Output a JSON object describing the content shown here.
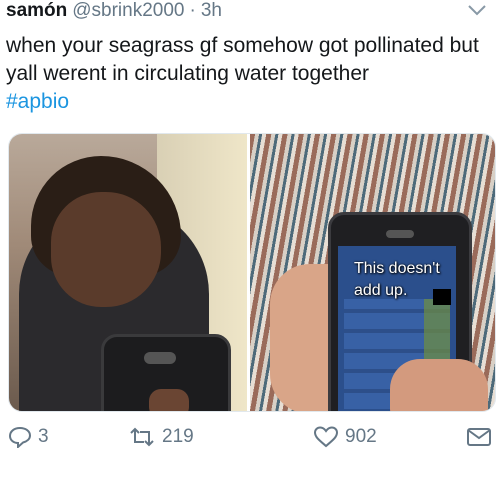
{
  "tweet": {
    "author": {
      "display_name": "samón",
      "handle": "@sbrink2000",
      "separator": "·",
      "time": "3h"
    },
    "text": "when your seagrass gf somehow got pollinated but yall werent in circulating water together",
    "hashtag": "#apbio",
    "image_right_caption_line1": "This doesn't",
    "image_right_caption_line2": "add up.",
    "actions": {
      "replies": "3",
      "retweets": "219",
      "likes": "902"
    }
  },
  "colors": {
    "text": "#14171a",
    "secondary": "#657786",
    "link": "#1b95e0"
  },
  "icons": [
    "chevron-down-icon",
    "reply-icon",
    "retweet-icon",
    "like-icon",
    "direct-message-icon"
  ]
}
